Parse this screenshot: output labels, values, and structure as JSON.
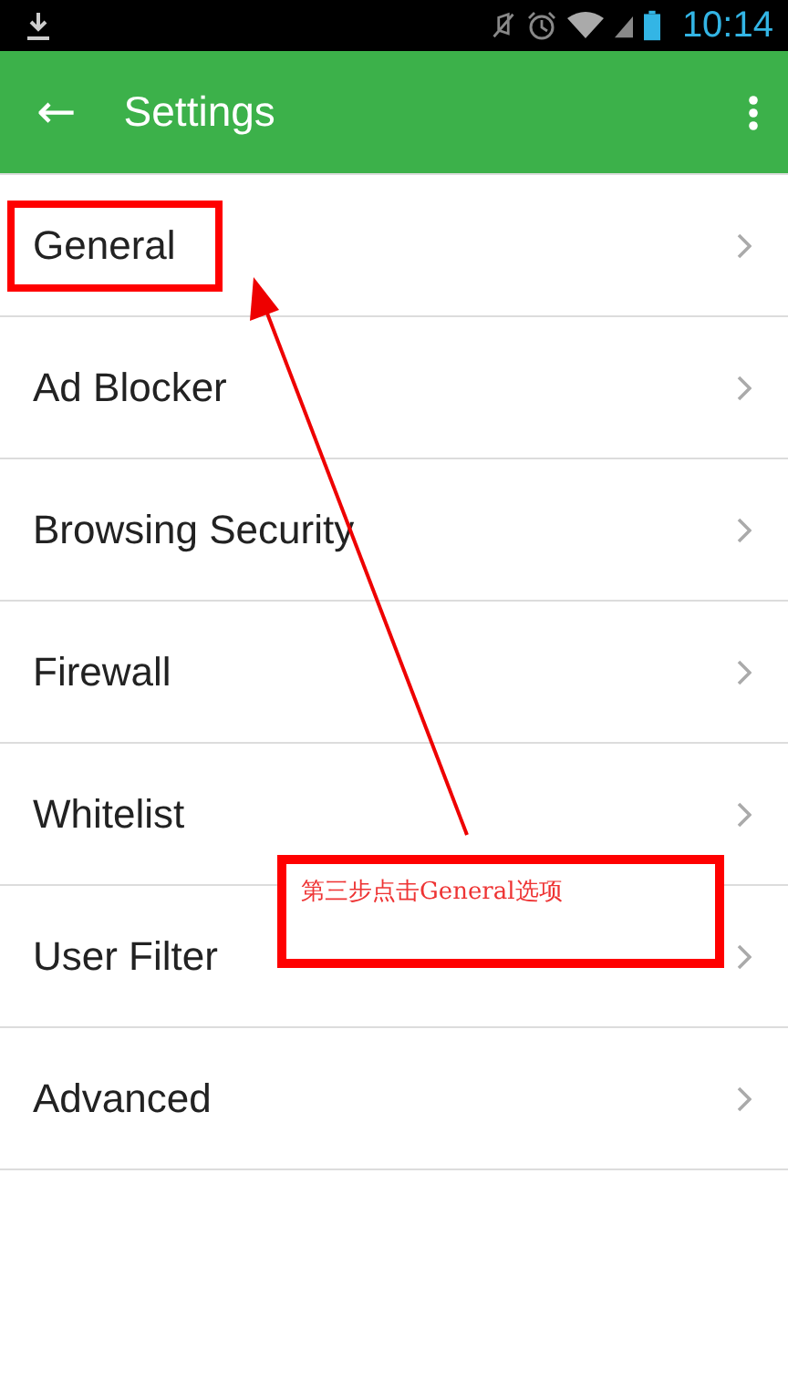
{
  "status_bar": {
    "time": "10:14"
  },
  "app_bar": {
    "back": "←",
    "title": "Settings"
  },
  "items": [
    {
      "label": "General",
      "highlighted": true
    },
    {
      "label": "Ad Blocker",
      "highlighted": false
    },
    {
      "label": "Browsing Security",
      "highlighted": false
    },
    {
      "label": "Firewall",
      "highlighted": false
    },
    {
      "label": "Whitelist",
      "highlighted": false
    },
    {
      "label": "User Filter",
      "highlighted": false
    },
    {
      "label": "Advanced",
      "highlighted": false
    }
  ],
  "annotation": {
    "text": "第三步点击General选项"
  }
}
